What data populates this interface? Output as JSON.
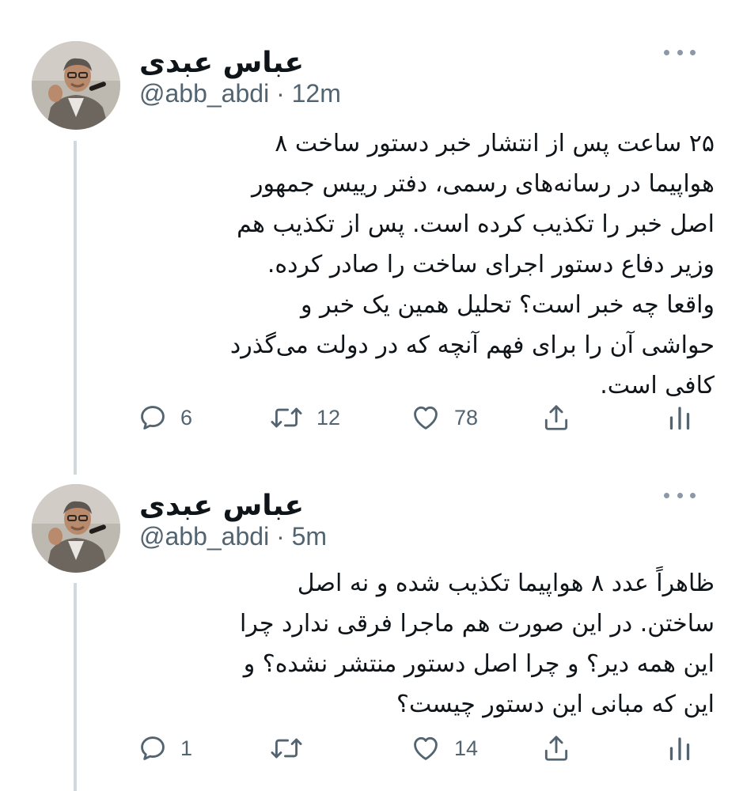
{
  "tweets": [
    {
      "author_name": "عباس عبدی",
      "handle": "@abb_abdi",
      "separator": "·",
      "time": "12m",
      "lines": [
        "۲۵ ساعت پس از انتشار خبر دستور ساخت ۸",
        "هواپیما در رسانه‌های رسمی، دفتر رییس جمهور",
        "اصل خبر را تکذیب کرده است. پس از تکذیب هم",
        "وزیر دفاع دستور اجرای ساخت را صادر کرده.",
        "واقعا چه خبر است؟ تحلیل همین یک خبر و",
        "حواشی آن را برای فهم آنچه که در دولت می‌گذرد",
        "کافی است."
      ],
      "replies": "6",
      "retweets": "12",
      "likes": "78"
    },
    {
      "author_name": "عباس عبدی",
      "handle": "@abb_abdi",
      "separator": "·",
      "time": "5m",
      "lines": [
        "ظاهراً عدد ۸ هواپیما تکذیب شده و نه اصل",
        "ساختن. در این صورت هم ماجرا فرقی ندارد چرا",
        "این همه دیر؟ و چرا اصل دستور منتشر نشده؟ و",
        "این که مبانی این دستور چیست؟"
      ],
      "replies": "1",
      "retweets": "",
      "likes": "14"
    }
  ],
  "icons": {
    "reply": "reply-icon",
    "retweet": "retweet-icon",
    "like": "heart-icon",
    "share": "share-icon",
    "analytics": "analytics-icon",
    "more": "more-icon"
  },
  "colors": {
    "text": "#0f1419",
    "secondary": "#536471",
    "thread_line": "#cfd9de"
  }
}
